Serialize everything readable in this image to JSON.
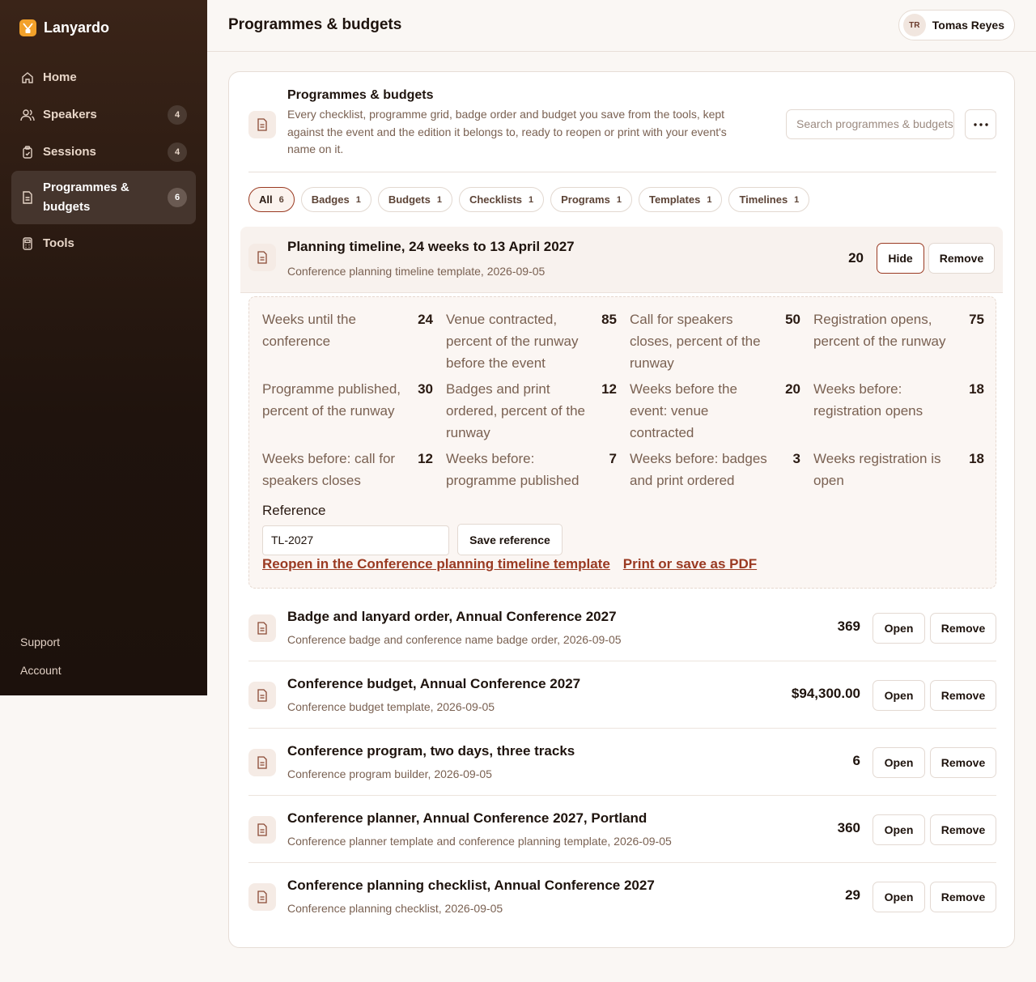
{
  "app": {
    "name": "Lanyardo"
  },
  "sidebar": {
    "items": [
      {
        "label": "Home",
        "icon": "home-icon"
      },
      {
        "label": "Speakers",
        "icon": "users-icon",
        "count": "4"
      },
      {
        "label": "Sessions",
        "icon": "clipboard-icon",
        "count": "4"
      },
      {
        "label": "Programmes & budgets",
        "icon": "document-icon",
        "count": "6",
        "active": true
      },
      {
        "label": "Tools",
        "icon": "calculator-icon"
      }
    ],
    "footer": [
      "Support",
      "Account"
    ]
  },
  "header": {
    "title": "Programmes & budgets",
    "user": {
      "initials": "TR",
      "name": "Tomas Reyes"
    }
  },
  "card": {
    "title": "Programmes & budgets",
    "description": "Every checklist, programme grid, badge order and budget you save from the tools, kept against the event and the edition it belongs to, ready to reopen or print with your event's name on it.",
    "search_placeholder": "Search programmes & budgets"
  },
  "filters": [
    {
      "label": "All",
      "count": "6",
      "active": true
    },
    {
      "label": "Badges",
      "count": "1"
    },
    {
      "label": "Budgets",
      "count": "1"
    },
    {
      "label": "Checklists",
      "count": "1"
    },
    {
      "label": "Programs",
      "count": "1"
    },
    {
      "label": "Templates",
      "count": "1"
    },
    {
      "label": "Timelines",
      "count": "1"
    }
  ],
  "expanded": {
    "title": "Planning timeline, 24 weeks to 13 April 2027",
    "subtitle": "Conference planning timeline template, 2026-09-05",
    "value": "20",
    "hide_label": "Hide",
    "remove_label": "Remove",
    "metrics": [
      {
        "label": "Weeks until the conference",
        "value": "24"
      },
      {
        "label": "Venue contracted, percent of the runway before the event",
        "value": "85"
      },
      {
        "label": "Call for speakers closes, percent of the runway",
        "value": "50"
      },
      {
        "label": "Registration opens, percent of the runway",
        "value": "75"
      },
      {
        "label": "Programme published, percent of the runway",
        "value": "30"
      },
      {
        "label": "Badges and print ordered, percent of the runway",
        "value": "12"
      },
      {
        "label": "Weeks before the event: venue contracted",
        "value": "20"
      },
      {
        "label": "Weeks before: registration opens",
        "value": "18"
      },
      {
        "label": "Weeks before: call for speakers closes",
        "value": "12"
      },
      {
        "label": "Weeks before: programme published",
        "value": "7"
      },
      {
        "label": "Weeks before: badges and print ordered",
        "value": "3"
      },
      {
        "label": "Weeks registration is open",
        "value": "18"
      }
    ],
    "reference_label": "Reference",
    "reference_value": "TL-2027",
    "save_reference_label": "Save reference",
    "reopen_link": "Reopen in the Conference planning timeline template",
    "print_link": "Print or save as PDF"
  },
  "rows": [
    {
      "title": "Badge and lanyard order, Annual Conference 2027",
      "subtitle": "Conference badge and conference name badge order, 2026-09-05",
      "value": "369",
      "open": "Open",
      "remove": "Remove"
    },
    {
      "title": "Conference budget, Annual Conference 2027",
      "subtitle": "Conference budget template, 2026-09-05",
      "value": "$94,300.00",
      "open": "Open",
      "remove": "Remove"
    },
    {
      "title": "Conference program, two days, three tracks",
      "subtitle": "Conference program builder, 2026-09-05",
      "value": "6",
      "open": "Open",
      "remove": "Remove"
    },
    {
      "title": "Conference planner, Annual Conference 2027, Portland",
      "subtitle": "Conference planner template and conference planning template, 2026-09-05",
      "value": "360",
      "open": "Open",
      "remove": "Remove"
    },
    {
      "title": "Conference planning checklist, Annual Conference 2027",
      "subtitle": "Conference planning checklist, 2026-09-05",
      "value": "29",
      "open": "Open",
      "remove": "Remove"
    }
  ],
  "colors": {
    "accent": "#9a3a22",
    "brand": "#f2a12a",
    "sidebar": "#2a1a12"
  }
}
